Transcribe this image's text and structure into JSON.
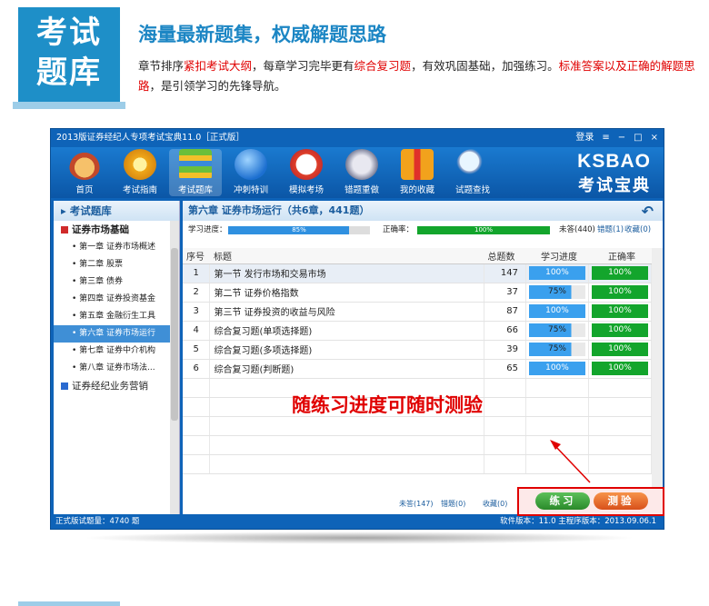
{
  "promo": {
    "badge_line1": "考试",
    "badge_line2": "题库",
    "headline": "海量最新题集，权威解题思路",
    "desc_p1": "章节排序",
    "desc_r1": "紧扣考试大纲",
    "desc_p2": "，每章学习完毕更有",
    "desc_r2": "综合复习题",
    "desc_p3": "，有效巩固基础，加强练习。",
    "desc_r3": "标准答案以及正确的解题思路",
    "desc_p4": "，是引领学习的先锋导航。"
  },
  "window": {
    "title": "2013版证券经纪人专项考试宝典11.0［正式版］",
    "controls": [
      "登录",
      "≡",
      "−",
      "□",
      "×"
    ]
  },
  "toolbar": {
    "items": [
      {
        "label": "首页",
        "icon": "home-icon"
      },
      {
        "label": "考试指南",
        "icon": "compass-icon"
      },
      {
        "label": "考试题库",
        "icon": "books-icon"
      },
      {
        "label": "冲刺特训",
        "icon": "globe-icon"
      },
      {
        "label": "模拟考场",
        "icon": "clock-icon"
      },
      {
        "label": "错题重做",
        "icon": "pen-icon"
      },
      {
        "label": "我的收藏",
        "icon": "gift-icon"
      },
      {
        "label": "试题查找",
        "icon": "search-icon"
      }
    ],
    "logo_top": "KSBAO",
    "logo_bottom": "考试宝典"
  },
  "sidebar": {
    "header": "考试题库",
    "group1": "证券市场基础",
    "items": [
      "第一章 证券市场概述",
      "第二章 股票",
      "第三章 债券",
      "第四章 证券投资基金",
      "第五章 金融衍生工具",
      "第六章 证券市场运行",
      "第七章 证券中介机构",
      "第八章 证券市场法..."
    ],
    "group2": "证券经纪业务营销"
  },
  "main": {
    "header": "第六章 证券市场运行（共6章，441题）",
    "progress_label": "学习进度：",
    "progress_value": "85%",
    "progress_fraction": 0.85,
    "accuracy_label": "正确率：",
    "accuracy_value": "100%",
    "accuracy_fraction": 1.0,
    "counts": {
      "unanswered": "未答(440)",
      "wrong": "错题(1)",
      "fav": "收藏(0)"
    },
    "columns": [
      "序号",
      "标题",
      "总题数",
      "学习进度",
      "正确率"
    ],
    "rows": [
      {
        "no": "1",
        "title": "第一节 发行市场和交易市场",
        "total": "147",
        "progress": "100%",
        "accuracy": "100%"
      },
      {
        "no": "2",
        "title": "第二节 证券价格指数",
        "total": "37",
        "progress": "75%",
        "accuracy": "100%"
      },
      {
        "no": "3",
        "title": "第三节 证券投资的收益与风险",
        "total": "87",
        "progress": "100%",
        "accuracy": "100%"
      },
      {
        "no": "4",
        "title": "综合复习题(单项选择题)",
        "total": "66",
        "progress": "75%",
        "accuracy": "100%"
      },
      {
        "no": "5",
        "title": "综合复习题(多项选择题)",
        "total": "39",
        "progress": "75%",
        "accuracy": "100%"
      },
      {
        "no": "6",
        "title": "综合复习题(判断题)",
        "total": "65",
        "progress": "100%",
        "accuracy": "100%"
      }
    ],
    "annotation": "随练习进度可随时测验",
    "footer": {
      "unanswered": "未答(147)",
      "wrong": "错题(0)",
      "fav": "收藏(0)"
    },
    "practice_label": "练习",
    "test_label": "测验"
  },
  "status": {
    "left": "正式版试题量：4740 题",
    "right": "软件版本：11.0 主程序版本：2013.09.06.1"
  },
  "colors": {
    "accent": "#1e8fc8",
    "window": "#0e63b8",
    "red": "#e00000",
    "green": "#13a52c"
  }
}
